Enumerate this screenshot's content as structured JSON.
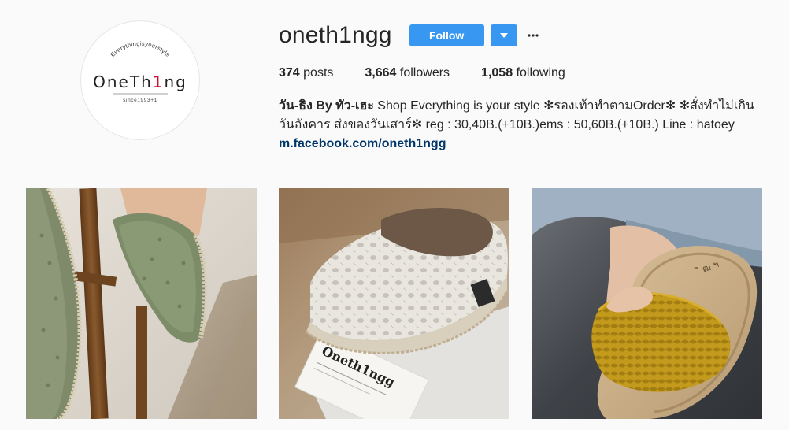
{
  "profile": {
    "username": "oneth1ngg",
    "follow_label": "Follow",
    "more_icon": "more-options-icon",
    "dropdown_icon": "caret-down-icon",
    "stats": [
      {
        "count": "374",
        "label": "posts"
      },
      {
        "count": "3,664",
        "label": "followers"
      },
      {
        "count": "1,058",
        "label": "following"
      }
    ],
    "bio": {
      "name": "วัน-ธิง By ทัว-เฮะ",
      "text": " Shop Everything is your style ✻รองเท้าทำตามOrder✻ ✻สั่งทำไม่เกินวันอังคาร ส่งของวันเสาร์✻ reg : 30,40B.(+10B.)ems : 50,60B.(+10B.) Line : hatoey",
      "link": "m.facebook.com/oneth1ngg"
    }
  },
  "logo": {
    "arc_text": "Everythingisyourstyle",
    "wordmark_a": "OneTh",
    "wordmark_accent": "1",
    "wordmark_b": "ng",
    "since_text": "since1993+1"
  },
  "posts": [
    {
      "subject": "green eyelet espadrilles on wooden chair"
    },
    {
      "subject": "white eyelet lace espadrille with oneth1ngg card",
      "card_text": "Oneth1ngg"
    },
    {
      "subject": "yellow woven slide sandal in hand"
    }
  ],
  "colors": {
    "accent_blue": "#3897f0",
    "link_blue": "#003569",
    "logo_accent": "#c8102e"
  }
}
